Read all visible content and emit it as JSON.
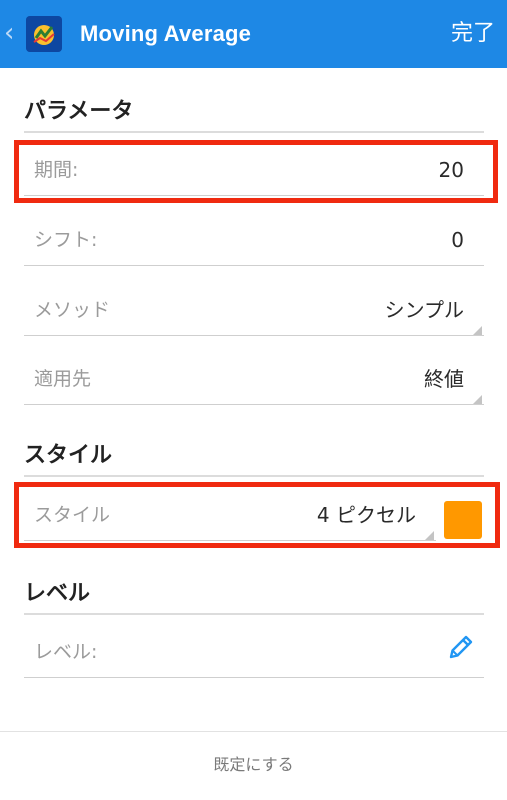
{
  "header": {
    "back_icon": "chevron-left-icon",
    "app_icon": "metatrader-icon",
    "title": "Moving Average",
    "done_label": "完了"
  },
  "sections": {
    "parameters": "パラメータ",
    "style": "スタイル",
    "level": "レベル"
  },
  "parameters": {
    "period": {
      "label": "期間:",
      "value": "20"
    },
    "shift": {
      "label": "シフト:",
      "value": "0"
    },
    "method": {
      "label": "メソッド",
      "value": "シンプル"
    },
    "apply_to": {
      "label": "適用先",
      "value": "終値"
    }
  },
  "style": {
    "label": "スタイル",
    "value": "4 ピクセル",
    "color": "#ff9800"
  },
  "level": {
    "label": "レベル:",
    "edit_icon": "pencil-icon"
  },
  "footer": {
    "reset_label": "既定にする"
  },
  "colors": {
    "appbar": "#1e88e5",
    "highlight": "#f02a10",
    "accent": "#2196f3"
  }
}
